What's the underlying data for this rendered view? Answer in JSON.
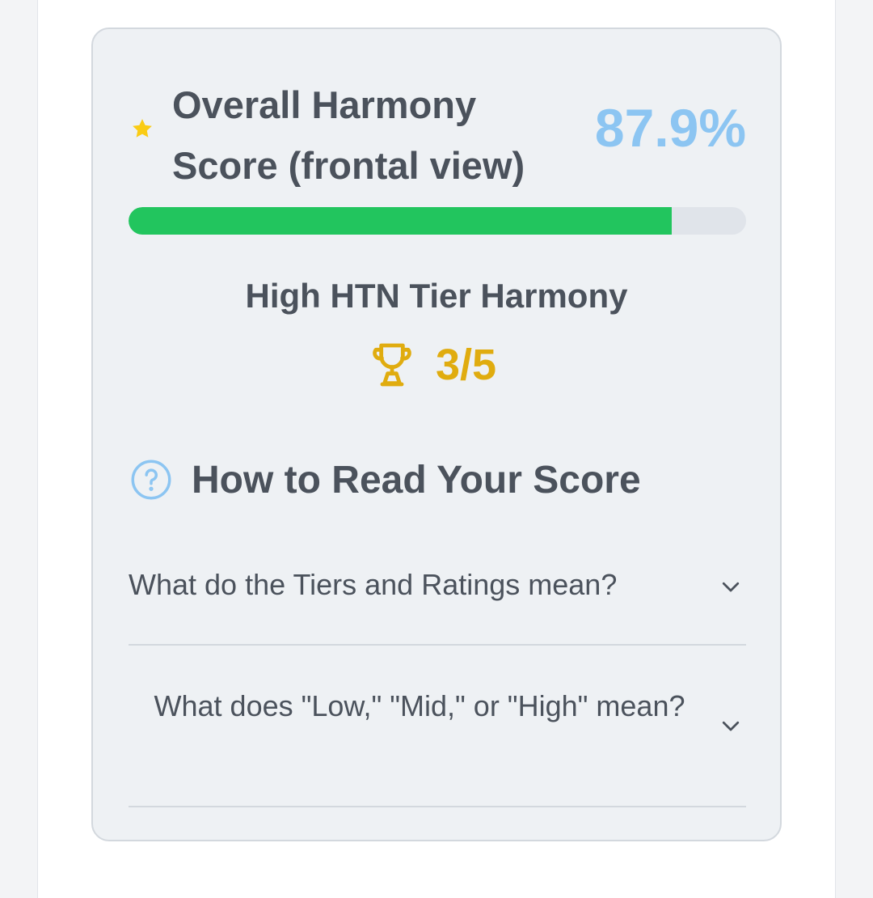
{
  "score": {
    "title": "Overall Harmony Score (frontal view)",
    "value_text": "87.9%",
    "progress_fraction": 0.879,
    "star_icon": "star-icon"
  },
  "tier": {
    "label": "High HTN Tier Harmony",
    "rating_text": "3/5",
    "trophy_icon": "trophy-icon"
  },
  "guide": {
    "title": "How to Read Your Score",
    "help_icon": "question-circle-icon",
    "faqs": [
      {
        "question": "What do the Tiers and Ratings mean?",
        "icon": "chevron-down-icon"
      },
      {
        "question": "What does \"Low,\" \"Mid,\" or \"High\" mean?",
        "icon": "chevron-down-icon"
      }
    ]
  },
  "colors": {
    "accent_blue": "#8cc5f2",
    "progress_green": "#22c55e",
    "trophy_gold": "#e0ac0f",
    "star_yellow": "#facc15",
    "text_dark": "#4b525c"
  }
}
